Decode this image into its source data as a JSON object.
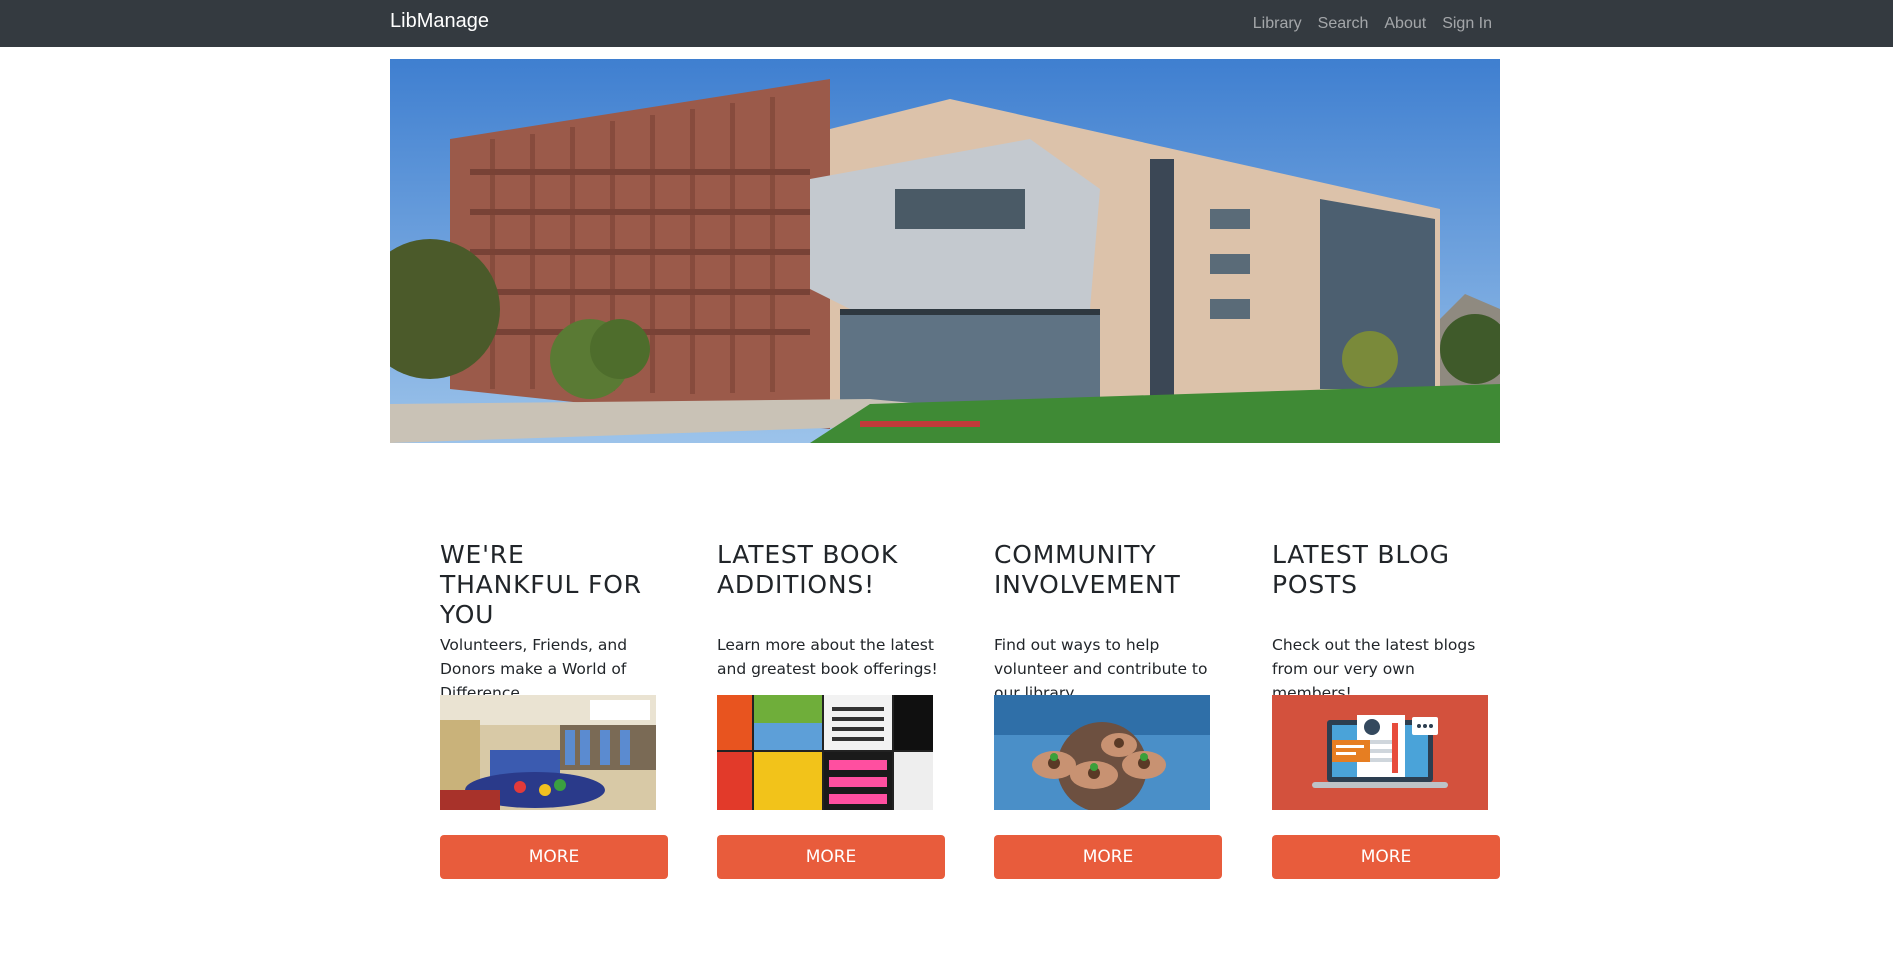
{
  "navbar": {
    "brand": "LibManage",
    "links": [
      "Library",
      "Search",
      "About",
      "Sign In"
    ]
  },
  "cards": [
    {
      "title": "WE'RE THANKFUL FOR YOU",
      "text": "Volunteers, Friends, and Donors make a World of Difference",
      "button": "MORE"
    },
    {
      "title": "LATEST BOOK ADDITIONS!",
      "text": "Learn more about the latest and greatest book offerings!",
      "button": "MORE"
    },
    {
      "title": "COMMUNITY INVOLVEMENT",
      "text": "Find out ways to help volunteer and contribute to our library.",
      "button": "MORE"
    },
    {
      "title": "LATEST BLOG POSTS",
      "text": "Check out the latest blogs from our very own members!.",
      "button": "MORE"
    }
  ],
  "colors": {
    "navbar": "#343a40",
    "accent": "#e85c3c"
  }
}
